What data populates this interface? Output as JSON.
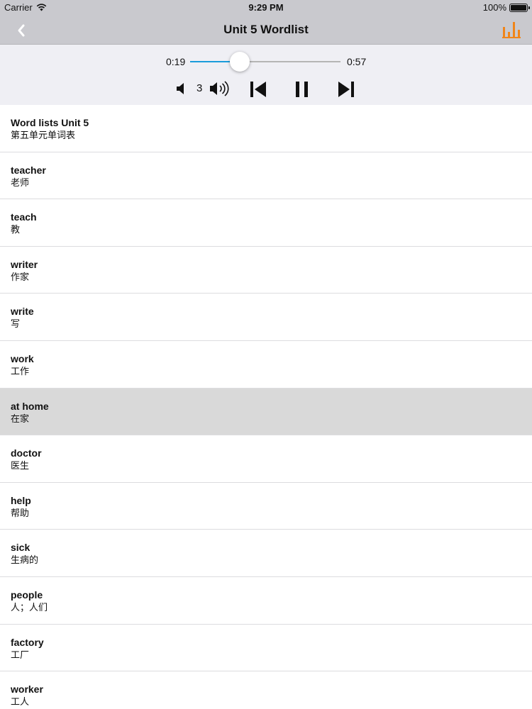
{
  "status_bar": {
    "carrier": "Carrier",
    "time": "9:29 PM",
    "battery": "100%"
  },
  "nav": {
    "title": "Unit 5 Wordlist",
    "back_icon": "chevron-left-icon",
    "chart_icon": "bar-chart-icon",
    "accent_color": "#f0851a"
  },
  "player": {
    "current_time": "0:19",
    "total_time": "0:57",
    "progress": 0.33,
    "volume_level": "3",
    "accent_color": "#1a9cdb"
  },
  "words": [
    {
      "en": "Word lists Unit 5",
      "zh": "第五单元单词表"
    },
    {
      "en": "teacher",
      "zh": "老师"
    },
    {
      "en": "teach",
      "zh": "教"
    },
    {
      "en": "writer",
      "zh": "作家"
    },
    {
      "en": "write",
      "zh": "写"
    },
    {
      "en": "work",
      "zh": "工作"
    },
    {
      "en": "at home",
      "zh": "在家",
      "selected": true
    },
    {
      "en": "doctor",
      "zh": "医生"
    },
    {
      "en": "help",
      "zh": "帮助"
    },
    {
      "en": "sick",
      "zh": "生病的"
    },
    {
      "en": "people",
      "zh": "人；人们"
    },
    {
      "en": "factory",
      "zh": "工厂"
    },
    {
      "en": "worker",
      "zh": "工人"
    }
  ]
}
